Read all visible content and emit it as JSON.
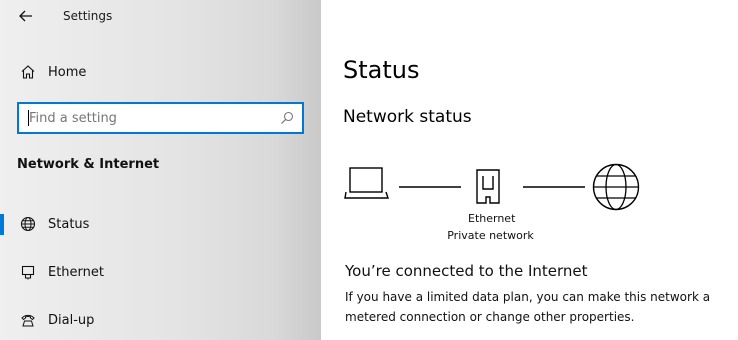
{
  "app": {
    "title": "Settings"
  },
  "nav": {
    "home_label": "Home",
    "search": {
      "placeholder": "Find a setting",
      "value": ""
    },
    "section_title": "Network & Internet",
    "items": [
      {
        "label": "Status",
        "icon": "globe-icon",
        "selected": true
      },
      {
        "label": "Ethernet",
        "icon": "ethernet-icon",
        "selected": false
      },
      {
        "label": "Dial-up",
        "icon": "dialup-icon",
        "selected": false
      }
    ]
  },
  "main": {
    "title": "Status",
    "subtitle": "Network status",
    "diagram": {
      "adapter_label": "Ethernet",
      "network_label": "Private network",
      "nodes": [
        "laptop-icon",
        "ethernet-port-icon",
        "globe-icon"
      ]
    },
    "connection_heading": "You’re connected to the Internet",
    "description": "If you have a limited data plan, you can make this network a metered connection or change other properties."
  },
  "colors": {
    "accent": "#0078d7",
    "nav_background": "#e6e6e6"
  }
}
